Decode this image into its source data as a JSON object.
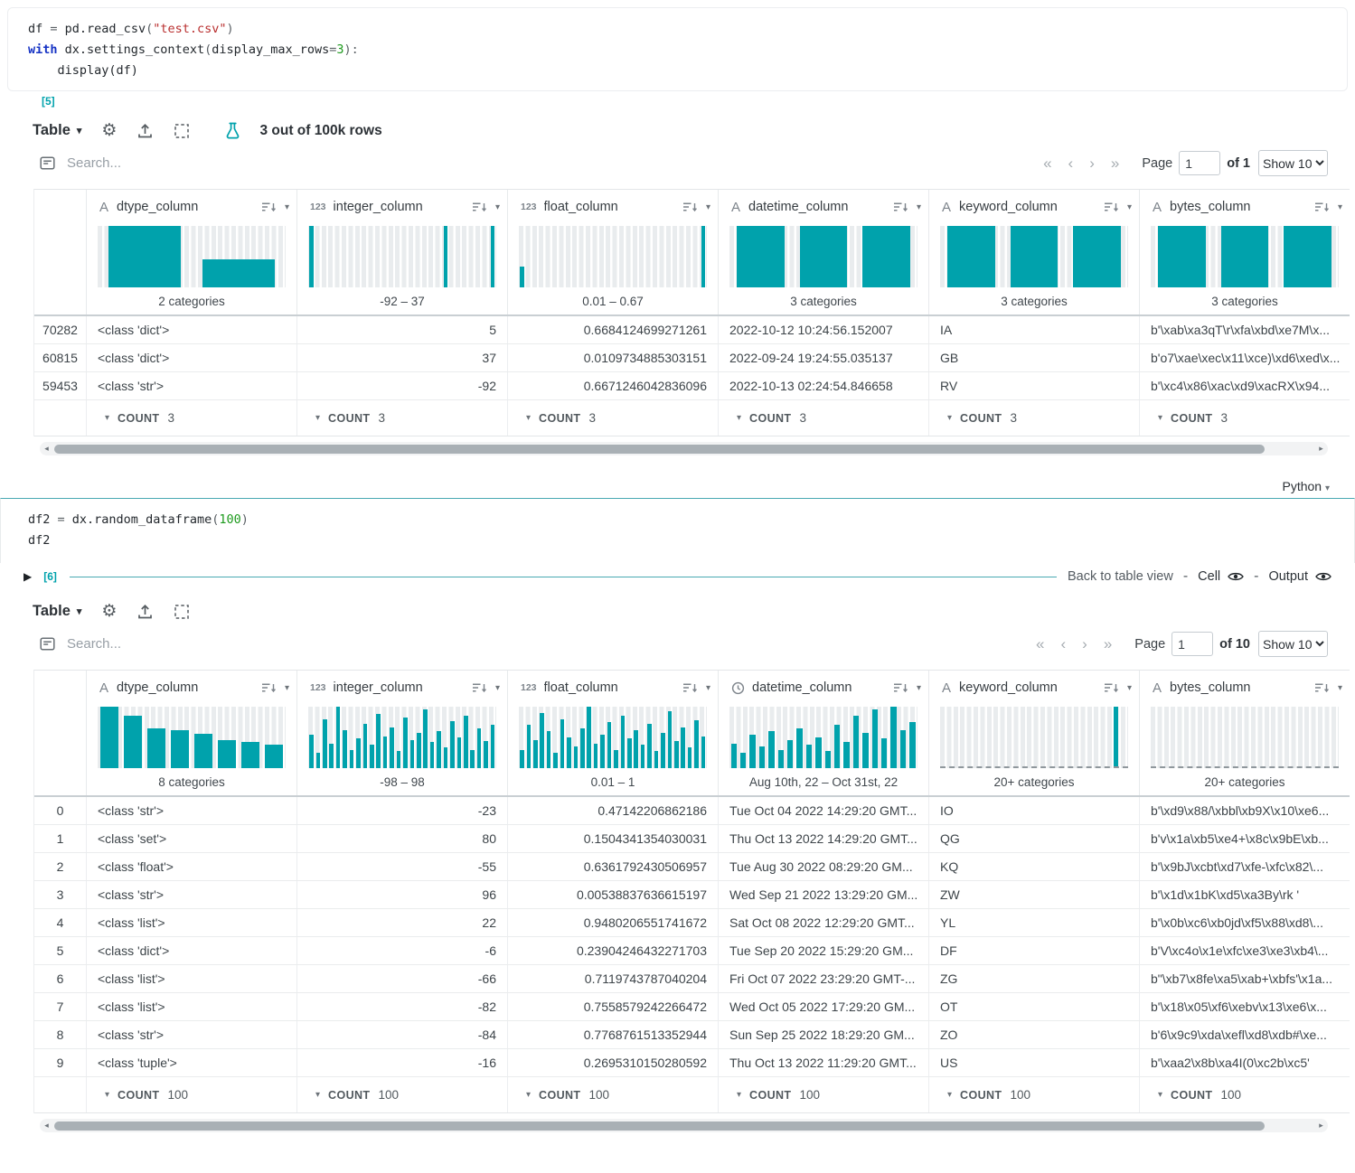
{
  "accent": "#00a2ac",
  "cell1": {
    "exec": "[5]",
    "lines": [
      [
        [
          "v",
          "df "
        ],
        [
          "o",
          "="
        ],
        [
          "v",
          " pd."
        ],
        [
          "f",
          "read_csv"
        ],
        [
          "o",
          "("
        ],
        [
          "s",
          "\"test.csv\""
        ],
        [
          "o",
          ")"
        ]
      ],
      [
        [
          "k",
          "with"
        ],
        [
          "v",
          " dx."
        ],
        [
          "f",
          "settings_context"
        ],
        [
          "o",
          "("
        ],
        [
          "v",
          "display_max_rows"
        ],
        [
          "o",
          "="
        ],
        [
          "n",
          "3"
        ],
        [
          "o",
          "):"
        ]
      ],
      [
        [
          "v",
          "    display(df)"
        ]
      ]
    ]
  },
  "cell2": {
    "exec": "[6]",
    "lang": "Python",
    "back": "Back to table view",
    "cell_label": "Cell",
    "output_label": "Output",
    "lines": [
      [
        [
          "v",
          "df2 "
        ],
        [
          "o",
          "="
        ],
        [
          "v",
          " dx."
        ],
        [
          "f",
          "random_dataframe"
        ],
        [
          "o",
          "("
        ],
        [
          "n",
          "100"
        ],
        [
          "o",
          ")"
        ]
      ],
      [
        [
          "v",
          "df2"
        ]
      ]
    ]
  },
  "table1": {
    "toolbar": {
      "view": "Table",
      "summary": "3 out of 100k rows"
    },
    "search_placeholder": "Search...",
    "pagination": {
      "page_label": "Page",
      "page": "1",
      "of": "of 1",
      "show": "Show 10"
    },
    "footer": {
      "label": "COUNT",
      "value": "3"
    },
    "columns": [
      {
        "icon": "A",
        "name": "dtype_column",
        "range": "2 categories",
        "hist": {
          "cats": [
            100,
            46
          ]
        }
      },
      {
        "icon": "123",
        "name": "integer_column",
        "range": "-92 – 37",
        "hist": {
          "bins": [
            100,
            0,
            0,
            0,
            0,
            0,
            0,
            0,
            0,
            0,
            0,
            0,
            0,
            0,
            0,
            0,
            0,
            0,
            0,
            0,
            100,
            0,
            0,
            0,
            0,
            0,
            0,
            100
          ]
        }
      },
      {
        "icon": "123",
        "name": "float_column",
        "range": "0.01 – 0.67",
        "hist": {
          "bins": [
            34,
            0,
            0,
            0,
            0,
            0,
            0,
            0,
            0,
            0,
            0,
            0,
            0,
            0,
            0,
            0,
            0,
            0,
            0,
            0,
            0,
            0,
            0,
            0,
            0,
            0,
            0,
            100
          ]
        }
      },
      {
        "icon": "A",
        "name": "datetime_column",
        "range": "3 categories",
        "hist": {
          "cats": [
            100,
            100,
            100
          ]
        }
      },
      {
        "icon": "A",
        "name": "keyword_column",
        "range": "3 categories",
        "hist": {
          "cats": [
            100,
            100,
            100
          ]
        }
      },
      {
        "icon": "A",
        "name": "bytes_column",
        "range": "3 categories",
        "hist": {
          "cats": [
            100,
            100,
            100
          ]
        }
      }
    ],
    "rows": [
      [
        "70282",
        "<class 'dict'>",
        "5",
        "0.6684124699271261",
        "2022-10-12 10:24:56.152007",
        "IA",
        "b'\\xab\\xa3qT\\r\\xfa\\xbd\\xe7M\\x..."
      ],
      [
        "60815",
        "<class 'dict'>",
        "37",
        "0.0109734885303151",
        "2022-09-24 19:24:55.035137",
        "GB",
        "b'o7\\xae\\xec\\x11\\xce)\\xd6\\xed\\x..."
      ],
      [
        "59453",
        "<class 'str'>",
        "-92",
        "0.6671246042836096",
        "2022-10-13 02:24:54.846658",
        "RV",
        "b'\\xc4\\x86\\xac\\xd9\\xacRX\\x94..."
      ]
    ]
  },
  "table2": {
    "toolbar": {
      "view": "Table",
      "summary": ""
    },
    "search_placeholder": "Search...",
    "pagination": {
      "page_label": "Page",
      "page": "1",
      "of": "of 10",
      "show": "Show 10"
    },
    "footer": {
      "label": "COUNT",
      "value": "100"
    },
    "columns": [
      {
        "icon": "A",
        "name": "dtype_column",
        "range": "8 categories",
        "hist": {
          "cats": [
            100,
            85,
            64,
            62,
            56,
            46,
            42,
            38
          ]
        }
      },
      {
        "icon": "123",
        "name": "integer_column",
        "range": "-98 – 98",
        "hist": {
          "bins": [
            55,
            25,
            80,
            40,
            100,
            62,
            30,
            48,
            72,
            38,
            88,
            52,
            66,
            28,
            82,
            46,
            58,
            95,
            42,
            60,
            34,
            76,
            50,
            86,
            30,
            64,
            44,
            70
          ]
        }
      },
      {
        "icon": "123",
        "name": "float_column",
        "range": "0.01 – 1",
        "hist": {
          "bins": [
            30,
            70,
            45,
            90,
            60,
            25,
            80,
            50,
            35,
            65,
            100,
            40,
            55,
            75,
            30,
            85,
            48,
            62,
            38,
            72,
            28,
            58,
            92,
            44,
            66,
            34,
            78,
            52
          ]
        }
      },
      {
        "icon": "clock",
        "name": "datetime_column",
        "range": "Aug 10th, 22 – Oct 31st, 22",
        "hist": {
          "bins": [
            40,
            25,
            55,
            35,
            60,
            30,
            45,
            65,
            38,
            50,
            28,
            70,
            42,
            85,
            58,
            95,
            48,
            100,
            62,
            75
          ]
        }
      },
      {
        "icon": "A",
        "name": "keyword_column",
        "range": "20+ categories",
        "hist": {
          "dashed": true,
          "bins": [
            0,
            0,
            0,
            0,
            0,
            0,
            0,
            0,
            0,
            0,
            0,
            0,
            0,
            0,
            0,
            0,
            0,
            0,
            0,
            0,
            0,
            0,
            100,
            0
          ]
        }
      },
      {
        "icon": "A",
        "name": "bytes_column",
        "range": "20+ categories",
        "hist": {
          "dashed": true,
          "bins": [
            0,
            0,
            0,
            0,
            0,
            0,
            0,
            0,
            0,
            0,
            0,
            0,
            0,
            0,
            0,
            0,
            0,
            0,
            0,
            0,
            0,
            0,
            0,
            0
          ]
        }
      }
    ],
    "rows": [
      [
        "0",
        "<class 'str'>",
        "-23",
        "0.47142206862186",
        "Tue Oct 04 2022 14:29:20 GMT...",
        "IO",
        "b'\\xd9\\x88/\\xbbl\\xb9X\\x10\\xe6..."
      ],
      [
        "1",
        "<class 'set'>",
        "80",
        "0.1504341354030031",
        "Thu Oct 13 2022 14:29:20 GMT...",
        "QG",
        "b'v\\x1a\\xb5\\xe4+\\x8c\\x9bE\\xb..."
      ],
      [
        "2",
        "<class 'float'>",
        "-55",
        "0.6361792430506957",
        "Tue Aug 30 2022 08:29:20 GM...",
        "KQ",
        "b'\\x9bJ\\xcbt\\xd7\\xfe-\\xfc\\x82\\..."
      ],
      [
        "3",
        "<class 'str'>",
        "96",
        "0.00538837636615197",
        "Wed Sep 21 2022 13:29:20 GM...",
        "ZW",
        "b'\\x1d\\x1bK\\xd5\\xa3By\\rk '"
      ],
      [
        "4",
        "<class 'list'>",
        "22",
        "0.9480206551741672",
        "Sat Oct 08 2022 12:29:20 GMT...",
        "YL",
        "b'\\x0b\\xc6\\xb0jd\\xf5\\x88\\xd8\\..."
      ],
      [
        "5",
        "<class 'dict'>",
        "-6",
        "0.23904246432271703",
        "Tue Sep 20 2022 15:29:20 GM...",
        "DF",
        "b'V\\xc4o\\x1e\\xfc\\xe3\\xe3\\xb4\\..."
      ],
      [
        "6",
        "<class 'list'>",
        "-66",
        "0.7119743787040204",
        "Fri Oct 07 2022 23:29:20 GMT-...",
        "ZG",
        "b\"\\xb7\\x8fe\\xa5\\xab+\\xbfs'\\x1a..."
      ],
      [
        "7",
        "<class 'list'>",
        "-82",
        "0.7558579242266472",
        "Wed Oct 05 2022 17:29:20 GM...",
        "OT",
        "b'\\x18\\x05\\xf6\\xebv\\x13\\xe6\\x..."
      ],
      [
        "8",
        "<class 'str'>",
        "-84",
        "0.7768761513352944",
        "Sun Sep 25 2022 18:29:20 GM...",
        "ZO",
        "b'6\\x9c9\\xda\\xefl\\xd8\\xdb#\\xe..."
      ],
      [
        "9",
        "<class 'tuple'>",
        "-16",
        "0.2695310150280592",
        "Thu Oct 13 2022 11:29:20 GMT...",
        "US",
        "b'\\xaa2\\x8b\\xa4I(0\\xc2b\\xc5'"
      ]
    ]
  }
}
